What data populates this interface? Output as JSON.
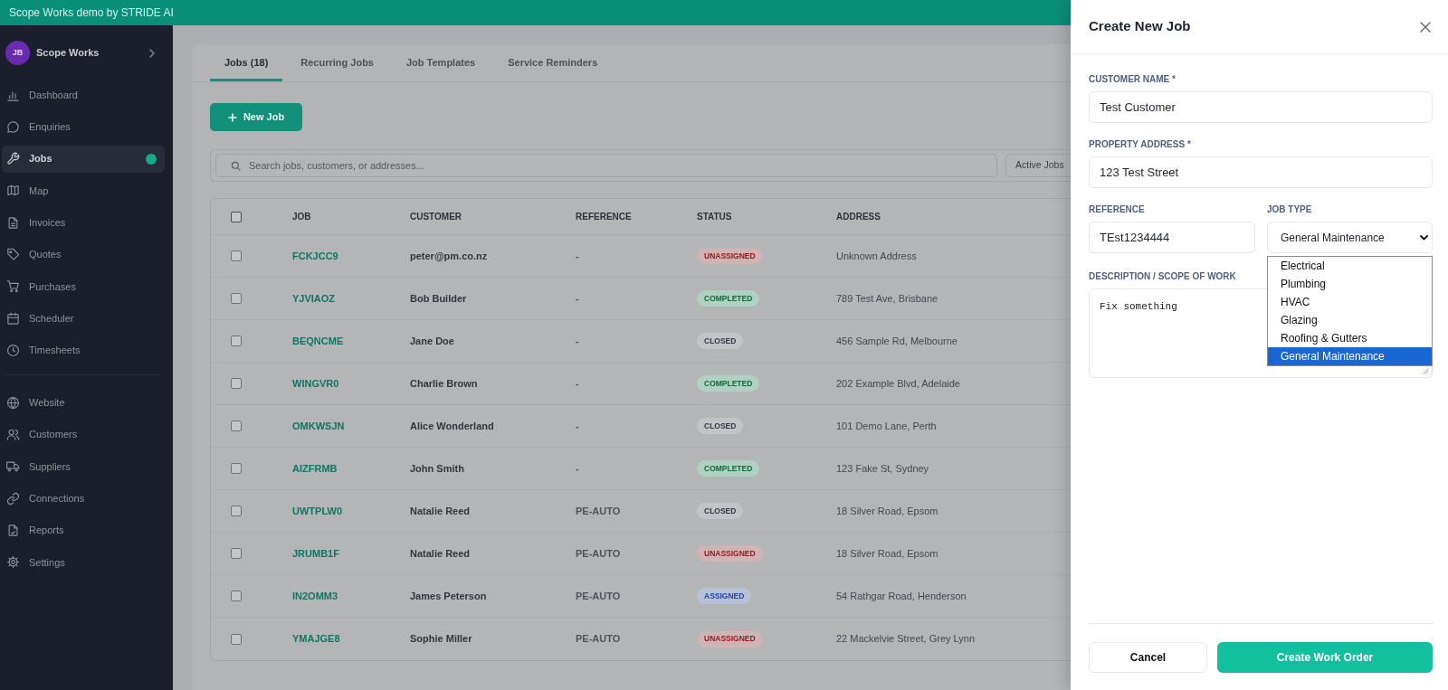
{
  "banner": {
    "text": "Scope Works demo by STRIDE AI"
  },
  "sidebar": {
    "workspace": {
      "initials": "JB",
      "name": "Scope Works"
    },
    "sections": [
      {
        "items": [
          {
            "label": "Dashboard",
            "selected": false,
            "dot": false
          },
          {
            "label": "Enquiries",
            "selected": false,
            "dot": false
          },
          {
            "label": "Jobs",
            "selected": true,
            "dot": true
          },
          {
            "label": "Map",
            "selected": false,
            "dot": false
          },
          {
            "label": "Invoices",
            "selected": false,
            "dot": false
          },
          {
            "label": "Quotes",
            "selected": false,
            "dot": false
          },
          {
            "label": "Purchases",
            "selected": false,
            "dot": false
          },
          {
            "label": "Scheduler",
            "selected": false,
            "dot": false
          },
          {
            "label": "Timesheets",
            "selected": false,
            "dot": false
          }
        ]
      },
      {
        "items": [
          {
            "label": "Website",
            "selected": false,
            "dot": false
          },
          {
            "label": "Customers",
            "selected": false,
            "dot": false
          },
          {
            "label": "Suppliers",
            "selected": false,
            "dot": false
          },
          {
            "label": "Connections",
            "selected": false,
            "dot": false
          },
          {
            "label": "Reports",
            "selected": false,
            "dot": false
          },
          {
            "label": "Settings",
            "selected": false,
            "dot": false
          }
        ]
      }
    ]
  },
  "tabs": [
    {
      "label": "Jobs (18)",
      "selected": true
    },
    {
      "label": "Recurring Jobs",
      "selected": false
    },
    {
      "label": "Job Templates",
      "selected": false
    },
    {
      "label": "Service Reminders",
      "selected": false
    }
  ],
  "toolbar": {
    "new_job_button": "New Job"
  },
  "search": {
    "placeholder": "Search jobs, customers, or addresses...",
    "filter": "Active Jobs"
  },
  "table": {
    "select_all": {
      "checked": false
    },
    "columns": [
      "JOB",
      "CUSTOMER",
      "REFERENCE",
      "STATUS",
      "ADDRESS"
    ],
    "rows": [
      {
        "checked": false,
        "job": "FCKJCC9",
        "customer": "peter@pm.co.nz",
        "reference": "-",
        "status": {
          "label": "UNASSIGNED",
          "kind": "unassigned"
        },
        "address": "Unknown Address"
      },
      {
        "checked": false,
        "job": "YJVIAOZ",
        "customer": "Bob Builder",
        "reference": "-",
        "status": {
          "label": "COMPLETED",
          "kind": "completed"
        },
        "address": "789 Test Ave, Brisbane"
      },
      {
        "checked": false,
        "job": "BEQNCME",
        "customer": "Jane Doe",
        "reference": "-",
        "status": {
          "label": "CLOSED",
          "kind": "closed"
        },
        "address": "456 Sample Rd, Melbourne"
      },
      {
        "checked": false,
        "job": "WINGVR0",
        "customer": "Charlie Brown",
        "reference": "-",
        "status": {
          "label": "COMPLETED",
          "kind": "completed"
        },
        "address": "202 Example Blvd, Adelaide"
      },
      {
        "checked": false,
        "job": "OMKWSJN",
        "customer": "Alice Wonderland",
        "reference": "-",
        "status": {
          "label": "CLOSED",
          "kind": "closed"
        },
        "address": "101 Demo Lane, Perth"
      },
      {
        "checked": false,
        "job": "AIZFRMB",
        "customer": "John Smith",
        "reference": "-",
        "status": {
          "label": "COMPLETED",
          "kind": "completed"
        },
        "address": "123 Fake St, Sydney"
      },
      {
        "checked": false,
        "job": "UWTPLW0",
        "customer": "Natalie Reed",
        "reference": "PE-AUTO",
        "status": {
          "label": "CLOSED",
          "kind": "closed"
        },
        "address": "18 Silver Road, Epsom"
      },
      {
        "checked": false,
        "job": "JRUMB1F",
        "customer": "Natalie Reed",
        "reference": "PE-AUTO",
        "status": {
          "label": "UNASSIGNED",
          "kind": "unassigned"
        },
        "address": "18 Silver Road, Epsom"
      },
      {
        "checked": false,
        "job": "IN2OMM3",
        "customer": "James Peterson",
        "reference": "PE-AUTO",
        "status": {
          "label": "ASSIGNED",
          "kind": "assigned"
        },
        "address": "54 Rathgar Road, Henderson"
      },
      {
        "checked": false,
        "job": "YMAJGE8",
        "customer": "Sophie Miller",
        "reference": "PE-AUTO",
        "status": {
          "label": "UNASSIGNED",
          "kind": "unassigned"
        },
        "address": "22 Mackelvie Street, Grey Lynn"
      }
    ]
  },
  "dialog": {
    "title": "Create New Job",
    "customer_name": {
      "label": "CUSTOMER NAME *",
      "value": "Test Customer"
    },
    "property_address": {
      "label": "PROPERTY ADDRESS *",
      "value": "123 Test Street"
    },
    "reference": {
      "label": "REFERENCE",
      "value": "TEst1234444"
    },
    "job_type": {
      "label": "JOB TYPE",
      "value": "General Maintenance",
      "options": [
        {
          "label": "Electrical",
          "selected": false
        },
        {
          "label": "Plumbing",
          "selected": false
        },
        {
          "label": "HVAC",
          "selected": false
        },
        {
          "label": "Glazing",
          "selected": false
        },
        {
          "label": "Roofing & Gutters",
          "selected": false
        },
        {
          "label": "General Maintenance",
          "selected": true
        }
      ]
    },
    "description": {
      "label": "DESCRIPTION / SCOPE OF WORK",
      "value": "Fix something"
    },
    "buttons": [
      {
        "label": "Cancel",
        "kind": "secondary"
      },
      {
        "label": "Create Work Order",
        "kind": "primary"
      }
    ]
  }
}
